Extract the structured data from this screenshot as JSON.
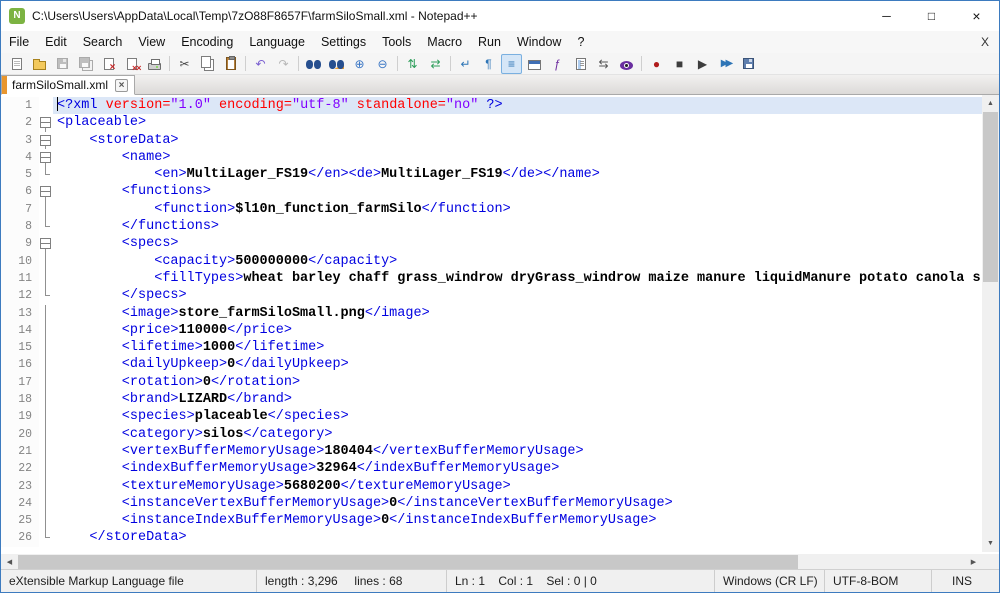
{
  "window": {
    "title": "C:\\Users\\Users\\AppData\\Local\\Temp\\7zO88F8657F\\farmSiloSmall.xml - Notepad++",
    "minimize_glyph": "─",
    "maximize_glyph": "□",
    "close_glyph": "×",
    "app_icon_letter": "N"
  },
  "menu": {
    "items": [
      "File",
      "Edit",
      "Search",
      "View",
      "Encoding",
      "Language",
      "Settings",
      "Tools",
      "Macro",
      "Run",
      "Window",
      "?"
    ],
    "right_label": "X"
  },
  "toolbar": {
    "items": [
      {
        "name": "new-file-button",
        "kind": "page"
      },
      {
        "name": "open-file-button",
        "kind": "folder"
      },
      {
        "name": "save-button",
        "kind": "floppy",
        "disabled": true
      },
      {
        "name": "save-all-button",
        "kind": "floppy2",
        "disabled": true
      },
      {
        "name": "close-button",
        "kind": "pagex"
      },
      {
        "name": "close-all-button",
        "kind": "pagexx"
      },
      {
        "name": "print-button",
        "kind": "printer"
      },
      {
        "sep": true
      },
      {
        "name": "cut-button",
        "kind": "glyph",
        "glyph": "✂",
        "color": "#444444"
      },
      {
        "name": "copy-button",
        "kind": "page2"
      },
      {
        "name": "paste-button",
        "kind": "clipboard"
      },
      {
        "sep": true
      },
      {
        "name": "undo-button",
        "kind": "glyph",
        "glyph": "↶",
        "color": "#7a5fd0"
      },
      {
        "name": "redo-button",
        "kind": "glyph",
        "glyph": "↷",
        "color": "#7a5fd0",
        "disabled": true
      },
      {
        "sep": true
      },
      {
        "name": "find-button",
        "kind": "binoc"
      },
      {
        "name": "replace-button",
        "kind": "binoc2"
      },
      {
        "name": "zoom-in-button",
        "kind": "glyph",
        "glyph": "⊕",
        "color": "#3a76c4"
      },
      {
        "name": "zoom-out-button",
        "kind": "glyph",
        "glyph": "⊖",
        "color": "#3a76c4"
      },
      {
        "sep": true
      },
      {
        "name": "sync-vertical-button",
        "kind": "glyph",
        "glyph": "⇅",
        "color": "#2e9e5b"
      },
      {
        "name": "sync-horizontal-button",
        "kind": "glyph",
        "glyph": "⇄",
        "color": "#2e9e5b"
      },
      {
        "sep": true
      },
      {
        "name": "word-wrap-button",
        "kind": "glyph",
        "glyph": "↵",
        "color": "#2e75b6"
      },
      {
        "name": "show-all-characters-button",
        "kind": "glyph",
        "glyph": "¶",
        "color": "#2e75b6"
      },
      {
        "name": "indent-guide-button",
        "kind": "glyph",
        "glyph": "≡",
        "color": "#2e75b6",
        "active": true
      },
      {
        "name": "user-defined-dialog-button",
        "kind": "window"
      },
      {
        "name": "function-list-button",
        "kind": "glyph",
        "glyph": "ƒ",
        "color": "#7030a0"
      },
      {
        "name": "document-map-button",
        "kind": "docmap"
      },
      {
        "name": "document-switcher-button",
        "kind": "glyph",
        "glyph": "⇆",
        "color": "#555555"
      },
      {
        "name": "monitoring-button",
        "kind": "eye"
      },
      {
        "sep": true
      },
      {
        "name": "record-macro-button",
        "kind": "glyph",
        "glyph": "●",
        "color": "#b01c1c"
      },
      {
        "name": "stop-recording-button",
        "kind": "glyph",
        "glyph": "■",
        "color": "#3d3d3d"
      },
      {
        "name": "playback-macro-button",
        "kind": "glyph",
        "glyph": "▶",
        "color": "#3d3d3d"
      },
      {
        "name": "run-macro-multiple-button",
        "kind": "glyph",
        "glyph": "▶▶",
        "color": "#2e75b6"
      },
      {
        "name": "save-macro-button",
        "kind": "floppy"
      }
    ]
  },
  "tabs": [
    {
      "label": "farmSiloSmall.xml",
      "close_glyph": "×"
    }
  ],
  "editor": {
    "lines": [
      {
        "n": 1,
        "fold": "none",
        "hl": true,
        "caret": true,
        "seg": [
          [
            "<?xml ",
            "tag"
          ],
          [
            "version=",
            "attr"
          ],
          [
            "\"1.0\"",
            "val"
          ],
          [
            " ",
            "plain"
          ],
          [
            "encoding=",
            "attr"
          ],
          [
            "\"utf-8\"",
            "val"
          ],
          [
            " ",
            "plain"
          ],
          [
            "standalone=",
            "attr"
          ],
          [
            "\"no\"",
            "val"
          ],
          [
            " ?>",
            "tag"
          ]
        ]
      },
      {
        "n": 2,
        "fold": "box",
        "seg": [
          [
            "<placeable>",
            "tag"
          ]
        ]
      },
      {
        "n": 3,
        "fold": "box",
        "seg": [
          [
            "    <storeData>",
            "tag"
          ]
        ]
      },
      {
        "n": 4,
        "fold": "box",
        "seg": [
          [
            "        <name>",
            "tag"
          ]
        ]
      },
      {
        "n": 5,
        "fold": "end",
        "seg": [
          [
            "            <en>",
            "tag"
          ],
          [
            "MultiLager_FS19",
            "txt"
          ],
          [
            "</en><de>",
            "tag"
          ],
          [
            "MultiLager_FS19",
            "txt"
          ],
          [
            "</de></name>",
            "tag"
          ]
        ]
      },
      {
        "n": 6,
        "fold": "box",
        "seg": [
          [
            "        <functions>",
            "tag"
          ]
        ]
      },
      {
        "n": 7,
        "fold": "line",
        "seg": [
          [
            "            <function>",
            "tag"
          ],
          [
            "$l10n_function_farmSilo",
            "txt"
          ],
          [
            "</function>",
            "tag"
          ]
        ]
      },
      {
        "n": 8,
        "fold": "end",
        "seg": [
          [
            "        </functions>",
            "tag"
          ]
        ]
      },
      {
        "n": 9,
        "fold": "box",
        "seg": [
          [
            "        <specs>",
            "tag"
          ]
        ]
      },
      {
        "n": 10,
        "fold": "line",
        "seg": [
          [
            "            <capacity>",
            "tag"
          ],
          [
            "500000000",
            "txt"
          ],
          [
            "</capacity>",
            "tag"
          ]
        ]
      },
      {
        "n": 11,
        "fold": "line",
        "seg": [
          [
            "            <fillTypes>",
            "tag"
          ],
          [
            "wheat barley chaff grass_windrow dryGrass_windrow maize manure liquidManure potato canola s",
            "txt"
          ]
        ]
      },
      {
        "n": 12,
        "fold": "end",
        "seg": [
          [
            "        </specs>",
            "tag"
          ]
        ]
      },
      {
        "n": 13,
        "fold": "line",
        "seg": [
          [
            "        <image>",
            "tag"
          ],
          [
            "store_farmSiloSmall.png",
            "txt"
          ],
          [
            "</image>",
            "tag"
          ]
        ]
      },
      {
        "n": 14,
        "fold": "line",
        "seg": [
          [
            "        <price>",
            "tag"
          ],
          [
            "110000",
            "txt"
          ],
          [
            "</price>",
            "tag"
          ]
        ]
      },
      {
        "n": 15,
        "fold": "line",
        "seg": [
          [
            "        <lifetime>",
            "tag"
          ],
          [
            "1000",
            "txt"
          ],
          [
            "</lifetime>",
            "tag"
          ]
        ]
      },
      {
        "n": 16,
        "fold": "line",
        "seg": [
          [
            "        <dailyUpkeep>",
            "tag"
          ],
          [
            "0",
            "txt"
          ],
          [
            "</dailyUpkeep>",
            "tag"
          ]
        ]
      },
      {
        "n": 17,
        "fold": "line",
        "seg": [
          [
            "        <rotation>",
            "tag"
          ],
          [
            "0",
            "txt"
          ],
          [
            "</rotation>",
            "tag"
          ]
        ]
      },
      {
        "n": 18,
        "fold": "line",
        "seg": [
          [
            "        <brand>",
            "tag"
          ],
          [
            "LIZARD",
            "txt"
          ],
          [
            "</brand>",
            "tag"
          ]
        ]
      },
      {
        "n": 19,
        "fold": "line",
        "seg": [
          [
            "        <species>",
            "tag"
          ],
          [
            "placeable",
            "txt"
          ],
          [
            "</species>",
            "tag"
          ]
        ]
      },
      {
        "n": 20,
        "fold": "line",
        "seg": [
          [
            "        <category>",
            "tag"
          ],
          [
            "silos",
            "txt"
          ],
          [
            "</category>",
            "tag"
          ]
        ]
      },
      {
        "n": 21,
        "fold": "line",
        "seg": [
          [
            "        <vertexBufferMemoryUsage>",
            "tag"
          ],
          [
            "180404",
            "txt"
          ],
          [
            "</vertexBufferMemoryUsage>",
            "tag"
          ]
        ]
      },
      {
        "n": 22,
        "fold": "line",
        "seg": [
          [
            "        <indexBufferMemoryUsage>",
            "tag"
          ],
          [
            "32964",
            "txt"
          ],
          [
            "</indexBufferMemoryUsage>",
            "tag"
          ]
        ]
      },
      {
        "n": 23,
        "fold": "line",
        "seg": [
          [
            "        <textureMemoryUsage>",
            "tag"
          ],
          [
            "5680200",
            "txt"
          ],
          [
            "</textureMemoryUsage>",
            "tag"
          ]
        ]
      },
      {
        "n": 24,
        "fold": "line",
        "seg": [
          [
            "        <instanceVertexBufferMemoryUsage>",
            "tag"
          ],
          [
            "0",
            "txt"
          ],
          [
            "</instanceVertexBufferMemoryUsage>",
            "tag"
          ]
        ]
      },
      {
        "n": 25,
        "fold": "line",
        "seg": [
          [
            "        <instanceIndexBufferMemoryUsage>",
            "tag"
          ],
          [
            "0",
            "txt"
          ],
          [
            "</instanceIndexBufferMemoryUsage>",
            "tag"
          ]
        ]
      },
      {
        "n": 26,
        "fold": "end",
        "seg": [
          [
            "    </storeData>",
            "tag"
          ]
        ]
      }
    ]
  },
  "scrollbar": {
    "up_glyph": "▲",
    "down_glyph": "▼",
    "left_glyph": "◀",
    "right_glyph": "▶"
  },
  "status": {
    "doc_type": "eXtensible Markup Language file",
    "length_info": "length : 3,296     lines : 68",
    "cursor_info": "Ln : 1    Col : 1    Sel : 0 | 0",
    "eol": "Windows (CR LF)",
    "encoding": "UTF-8-BOM",
    "insert_mode": "INS"
  }
}
